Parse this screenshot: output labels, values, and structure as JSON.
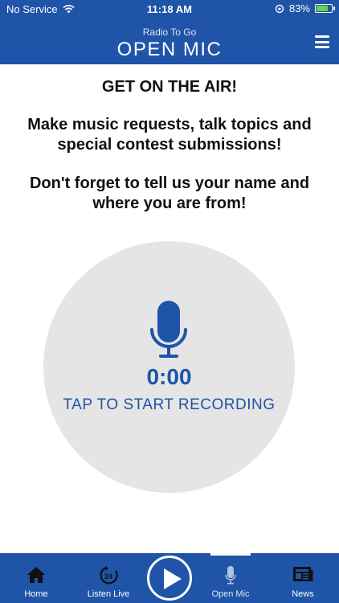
{
  "status_bar": {
    "carrier": "No Service",
    "time": "11:18 AM",
    "battery_percent": "83%",
    "battery_level": 0.83
  },
  "header": {
    "subtitle": "Radio To Go",
    "title": "OPEN MIC",
    "menu_icon": "hamburger-menu-icon"
  },
  "content": {
    "headline": "GET ON THE AIR!",
    "paragraph1": "Make music requests, talk topics and special contest submissions!",
    "paragraph2": "Don't forget to tell us your name and where you are from!"
  },
  "recorder": {
    "timer": "0:00",
    "label": "TAP TO START RECORDING",
    "icon": "microphone-icon"
  },
  "tabs": [
    {
      "label": "Home",
      "icon": "home-icon"
    },
    {
      "label": "Listen Live",
      "icon": "listen-live-24-icon"
    },
    {
      "label": "",
      "icon": "play-icon"
    },
    {
      "label": "Open Mic",
      "icon": "microphone-icon",
      "active": true
    },
    {
      "label": "News",
      "icon": "newspaper-icon"
    }
  ],
  "colors": {
    "brand": "#1f54a8",
    "circle": "#e5e5e5",
    "battery": "#6ad24a"
  }
}
